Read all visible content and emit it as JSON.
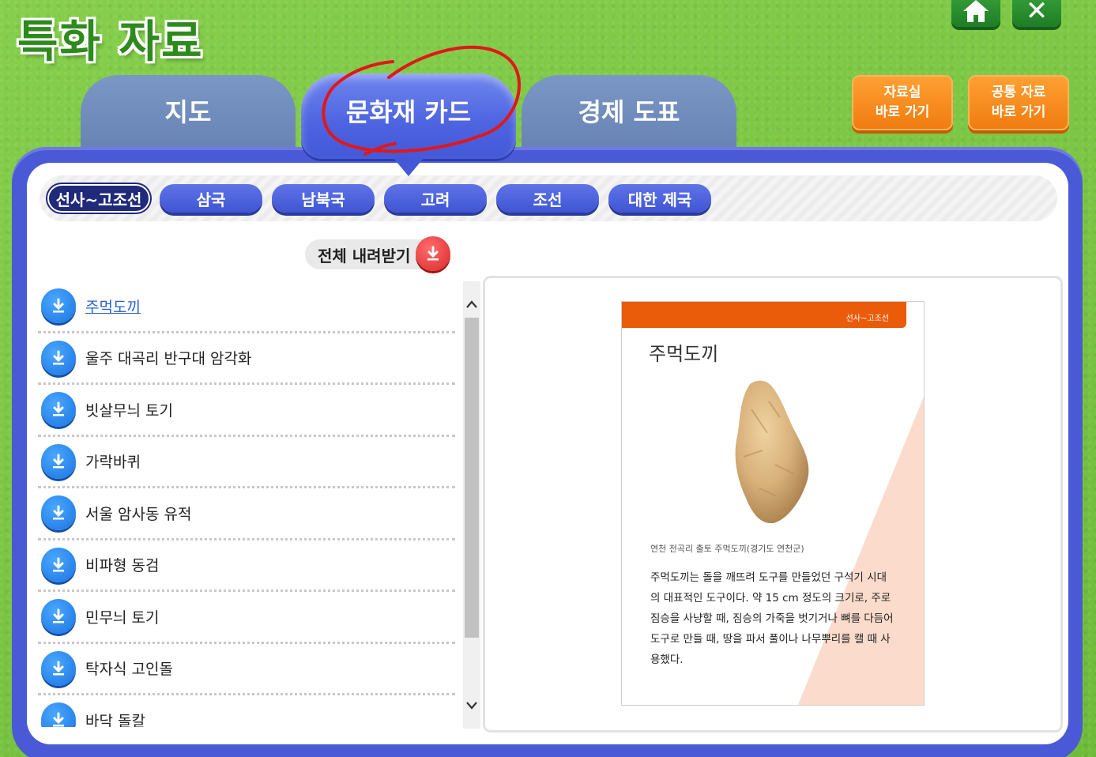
{
  "header": {
    "title": "특화 자료"
  },
  "top_buttons": {
    "home_icon": "home-icon",
    "close_icon": "close-icon",
    "close_glyph": "✕"
  },
  "tabs": [
    {
      "label": "지도"
    },
    {
      "label": "문화재 카드",
      "active": true
    },
    {
      "label": "경제 도표"
    }
  ],
  "quick_links": [
    {
      "line1": "자료실",
      "line2": "바로 가기"
    },
    {
      "line1": "공통 자료",
      "line2": "바로 가기"
    }
  ],
  "eras": [
    {
      "label": "선사~고조선",
      "active": true
    },
    {
      "label": "삼국"
    },
    {
      "label": "남북국"
    },
    {
      "label": "고려"
    },
    {
      "label": "조선"
    },
    {
      "label": "대한 제국"
    }
  ],
  "download_all_label": "전체 내려받기",
  "items": [
    {
      "label": "주먹도끼",
      "selected": true
    },
    {
      "label": "울주 대곡리 반구대 암각화"
    },
    {
      "label": "빗살무늬 토기"
    },
    {
      "label": "가락바퀴"
    },
    {
      "label": "서울 암사동 유적"
    },
    {
      "label": "비파형 동검"
    },
    {
      "label": "민무늬 토기"
    },
    {
      "label": "탁자식 고인돌"
    },
    {
      "label": "바닥 돌칼"
    }
  ],
  "card": {
    "era": "선사~고조선",
    "title": "주먹도끼",
    "caption": "연천 전곡리 출토 주먹도끼(경기도 연천군)",
    "description": "주먹도끼는 돌을 깨뜨려 도구를 만들었던 구석기 시대의 대표적인 도구이다. 약 15 cm 정도의 크기로, 주로 짐승을 사냥할 때, 짐승의 가죽을 벗기거나 뼈를 다듬어 도구로 만들 때, 땅을 파서 풀이나 나무뿌리를 캘 때 사용했다.",
    "accent_color": "#ea5b0a"
  },
  "colors": {
    "background": "#7cc644",
    "panel": "#4a59d6",
    "active_tab": "#4d63e0",
    "orange": "#f07c10"
  }
}
